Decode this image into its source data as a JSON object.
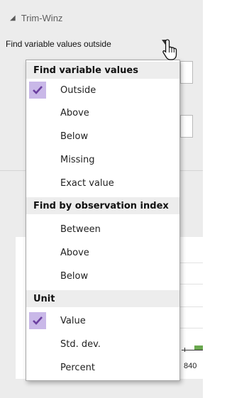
{
  "panel": {
    "section_title": "Trim-Winz",
    "find_select_value": "Find variable values outside"
  },
  "chart": {
    "tick_label": "840"
  },
  "menu": {
    "groups": [
      {
        "header": "Find variable values",
        "items": [
          {
            "label": "Outside",
            "checked": true
          },
          {
            "label": "Above",
            "checked": false
          },
          {
            "label": "Below",
            "checked": false
          },
          {
            "label": "Missing",
            "checked": false
          },
          {
            "label": "Exact value",
            "checked": false
          }
        ]
      },
      {
        "header": "Find by observation index",
        "items": [
          {
            "label": "Between",
            "checked": false
          },
          {
            "label": "Above",
            "checked": false
          },
          {
            "label": "Below",
            "checked": false
          }
        ]
      },
      {
        "header": "Unit",
        "items": [
          {
            "label": "Value",
            "checked": true
          },
          {
            "label": "Std. dev.",
            "checked": false
          },
          {
            "label": "Percent",
            "checked": false
          }
        ]
      }
    ]
  },
  "colors": {
    "check_bg": "#c9b8e8",
    "check_mark": "#6b3fa0",
    "group_header_bg": "#ededed",
    "plot_mark": "#6aa84f"
  }
}
